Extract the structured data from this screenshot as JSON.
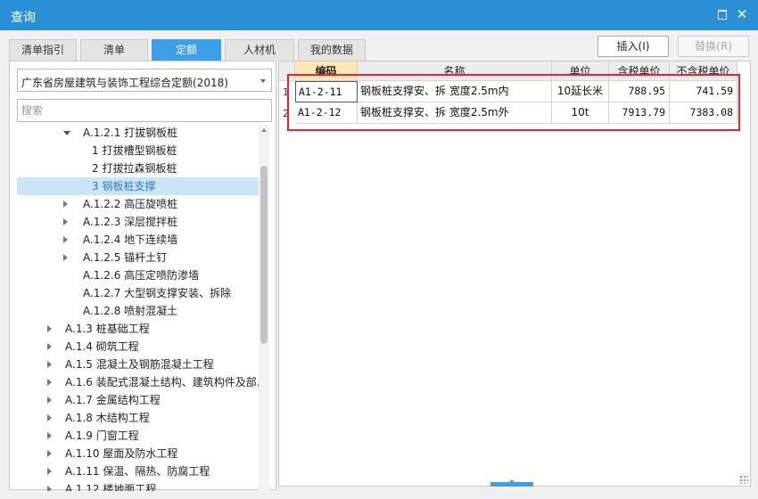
{
  "window": {
    "title": "查询"
  },
  "tabs": [
    {
      "label": "清单指引",
      "active": false
    },
    {
      "label": "清单",
      "active": false
    },
    {
      "label": "定额",
      "active": true
    },
    {
      "label": "人材机",
      "active": false
    },
    {
      "label": "我的数据",
      "active": false
    }
  ],
  "toolbar": {
    "insert_label": "插入(I)",
    "replace_label": "替换(R)"
  },
  "left": {
    "library": "广东省房屋建筑与装饰工程综合定额(2018)",
    "search_placeholder": "搜索",
    "tree": [
      {
        "label": "A.1.2.1 打拔钢板桩",
        "level": 2,
        "toggle": "expanded",
        "selected": false
      },
      {
        "label": "1 打拔槽型钢板桩",
        "level": 3,
        "toggle": "none",
        "selected": false
      },
      {
        "label": "2 打拔拉森钢板桩",
        "level": 3,
        "toggle": "none",
        "selected": false
      },
      {
        "label": "3 钢板桩支撑",
        "level": 3,
        "toggle": "none",
        "selected": true
      },
      {
        "label": "A.1.2.2 高压旋喷桩",
        "level": 2,
        "toggle": "collapsed",
        "selected": false
      },
      {
        "label": "A.1.2.3 深层搅拌桩",
        "level": 2,
        "toggle": "collapsed",
        "selected": false
      },
      {
        "label": "A.1.2.4 地下连续墙",
        "level": 2,
        "toggle": "collapsed",
        "selected": false
      },
      {
        "label": "A.1.2.5 锚杆土钉",
        "level": 2,
        "toggle": "collapsed",
        "selected": false
      },
      {
        "label": "A.1.2.6 高压定喷防渗墙",
        "level": 2,
        "toggle": "none",
        "selected": false
      },
      {
        "label": "A.1.2.7 大型钢支撑安装、拆除",
        "level": 2,
        "toggle": "none",
        "selected": false
      },
      {
        "label": "A.1.2.8 喷射混凝土",
        "level": 2,
        "toggle": "none",
        "selected": false
      },
      {
        "label": "A.1.3 桩基础工程",
        "level": 1,
        "toggle": "collapsed",
        "selected": false
      },
      {
        "label": "A.1.4 砌筑工程",
        "level": 1,
        "toggle": "collapsed",
        "selected": false
      },
      {
        "label": "A.1.5 混凝土及钢筋混凝土工程",
        "level": 1,
        "toggle": "collapsed",
        "selected": false
      },
      {
        "label": "A.1.6 装配式混凝土结构、建筑构件及部...",
        "level": 1,
        "toggle": "collapsed",
        "selected": false
      },
      {
        "label": "A.1.7 金属结构工程",
        "level": 1,
        "toggle": "collapsed",
        "selected": false
      },
      {
        "label": "A.1.8 木结构工程",
        "level": 1,
        "toggle": "collapsed",
        "selected": false
      },
      {
        "label": "A.1.9 门窗工程",
        "level": 1,
        "toggle": "collapsed",
        "selected": false
      },
      {
        "label": "A.1.10 屋面及防水工程",
        "level": 1,
        "toggle": "collapsed",
        "selected": false
      },
      {
        "label": "A.1.11 保温、隔热、防腐工程",
        "level": 1,
        "toggle": "collapsed",
        "selected": false
      },
      {
        "label": "A.1.12 楼地面工程",
        "level": 1,
        "toggle": "collapsed",
        "selected": false
      }
    ]
  },
  "table": {
    "columns": [
      "编码",
      "名称",
      "单位",
      "含税单价",
      "不含税单价"
    ],
    "rows": [
      {
        "marker": "1",
        "code": "A1-2-11",
        "name": "钢板桩支撑安、拆 宽度2.5m内",
        "unit": "10延长米",
        "price_tax": "788.95",
        "price_notax": "741.59"
      },
      {
        "marker": "2",
        "code": "A1-2-12",
        "name": "钢板桩支撑安、拆 宽度2.5m外",
        "unit": "10t",
        "price_tax": "7913.79",
        "price_notax": "7383.08"
      }
    ]
  },
  "colors": {
    "titlebar": "#2b8fd6",
    "active_tab": "#3f9ee8",
    "highlight": "#e8242c",
    "selected_row": "#cce4f7",
    "key_header": "#fce7b8"
  }
}
